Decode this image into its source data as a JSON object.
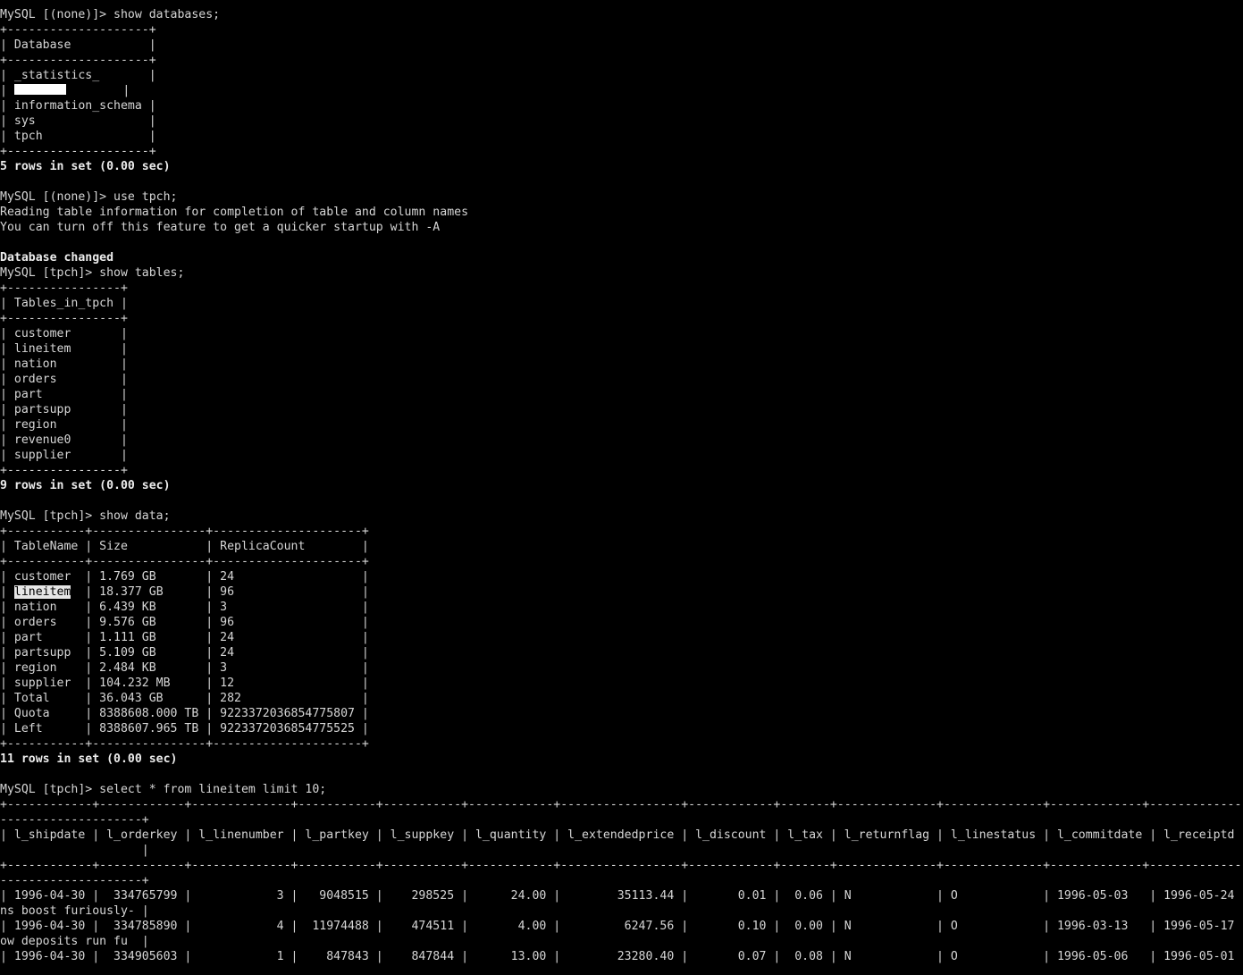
{
  "terminal": {
    "colors": {
      "background": "#000000",
      "foreground": "#d6d6d6",
      "bold": "#ececec",
      "selection": "#e6e6e6"
    },
    "lines": [
      {
        "text": "MySQL [(none)]> show databases;"
      },
      {
        "text": "+--------------------+"
      },
      {
        "text": "| Database           |"
      },
      {
        "text": "+--------------------+"
      },
      {
        "text": "| _statistics_       |"
      },
      {
        "segments": [
          {
            "text": "| "
          },
          {
            "redacted": true
          },
          {
            "text": "        |"
          }
        ]
      },
      {
        "text": "| information_schema |"
      },
      {
        "text": "| sys                |"
      },
      {
        "text": "| tpch               |"
      },
      {
        "text": "+--------------------+"
      },
      {
        "text": "5 rows in set (0.00 sec)",
        "bold": true
      },
      {
        "text": ""
      },
      {
        "text": "MySQL [(none)]> use tpch;"
      },
      {
        "text": "Reading table information for completion of table and column names"
      },
      {
        "text": "You can turn off this feature to get a quicker startup with -A"
      },
      {
        "text": ""
      },
      {
        "text": "Database changed",
        "bold": true
      },
      {
        "text": "MySQL [tpch]> show tables;"
      },
      {
        "text": "+----------------+"
      },
      {
        "text": "| Tables_in_tpch |"
      },
      {
        "text": "+----------------+"
      },
      {
        "text": "| customer       |"
      },
      {
        "text": "| lineitem       |"
      },
      {
        "text": "| nation         |"
      },
      {
        "text": "| orders         |"
      },
      {
        "text": "| part           |"
      },
      {
        "text": "| partsupp       |"
      },
      {
        "text": "| region         |"
      },
      {
        "text": "| revenue0       |"
      },
      {
        "text": "| supplier       |"
      },
      {
        "text": "+----------------+"
      },
      {
        "text": "9 rows in set (0.00 sec)",
        "bold": true
      },
      {
        "text": ""
      },
      {
        "text": "MySQL [tpch]> show data;"
      },
      {
        "text": "+-----------+----------------+---------------------+"
      },
      {
        "text": "| TableName | Size           | ReplicaCount        |"
      },
      {
        "text": "+-----------+----------------+---------------------+"
      },
      {
        "text": "| customer  | 1.769 GB       | 24                  |"
      },
      {
        "segments": [
          {
            "text": "| "
          },
          {
            "text": "lineitem",
            "highlight": true
          },
          {
            "text": "  | 18.377 GB      | 96                  |"
          }
        ]
      },
      {
        "text": "| nation    | 6.439 KB       | 3                   |"
      },
      {
        "text": "| orders    | 9.576 GB       | 96                  |"
      },
      {
        "text": "| part      | 1.111 GB       | 24                  |"
      },
      {
        "text": "| partsupp  | 5.109 GB       | 24                  |"
      },
      {
        "text": "| region    | 2.484 KB       | 3                   |"
      },
      {
        "text": "| supplier  | 104.232 MB     | 12                  |"
      },
      {
        "text": "| Total     | 36.043 GB      | 282                 |"
      },
      {
        "text": "| Quota     | 8388608.000 TB | 9223372036854775807 |"
      },
      {
        "text": "| Left      | 8388607.965 TB | 9223372036854775525 |"
      },
      {
        "text": "+-----------+----------------+---------------------+"
      },
      {
        "text": "11 rows in set (0.00 sec)",
        "bold": true
      },
      {
        "text": ""
      },
      {
        "text": "MySQL [tpch]> select * from lineitem limit 10;"
      },
      {
        "text": "+------------+------------+--------------+-----------+-----------+------------+-----------------+------------+-------+--------------+--------------+-------------+-------------"
      },
      {
        "text": "--------------------+"
      },
      {
        "text": "| l_shipdate | l_orderkey | l_linenumber | l_partkey | l_suppkey | l_quantity | l_extendedprice | l_discount | l_tax | l_returnflag | l_linestatus | l_commitdate | l_receiptd"
      },
      {
        "text": "                    |"
      },
      {
        "text": "+------------+------------+--------------+-----------+-----------+------------+-----------------+------------+-------+--------------+--------------+-------------+-------------"
      },
      {
        "text": "--------------------+"
      },
      {
        "text": "| 1996-04-30 |  334765799 |            3 |   9048515 |    298525 |      24.00 |        35113.44 |       0.01 |  0.06 | N            | O            | 1996-05-03   | 1996-05-24"
      },
      {
        "text": "ns boost furiously- |"
      },
      {
        "text": "| 1996-04-30 |  334785890 |            4 |  11974488 |    474511 |       4.00 |         6247.56 |       0.10 |  0.00 | N            | O            | 1996-03-13   | 1996-05-17"
      },
      {
        "text": "ow deposits run fu  |"
      },
      {
        "text": "| 1996-04-30 |  334905603 |            1 |    847843 |    847844 |      13.00 |        23280.40 |       0.07 |  0.08 | N            | O            | 1996-05-06   | 1996-05-01"
      }
    ]
  }
}
